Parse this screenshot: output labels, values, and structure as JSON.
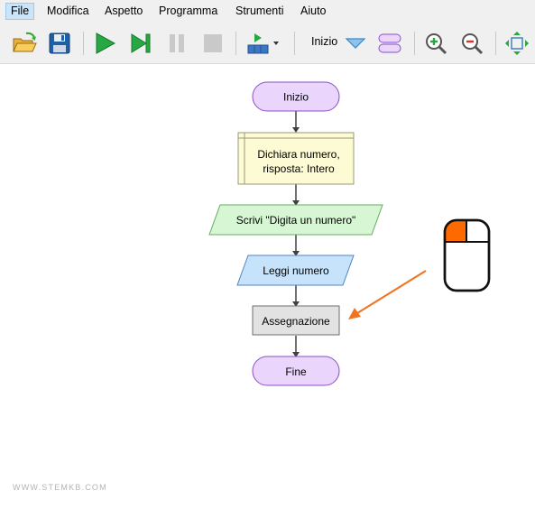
{
  "menu": {
    "items": [
      {
        "label": "File",
        "active": true
      },
      {
        "label": "Modifica"
      },
      {
        "label": "Aspetto"
      },
      {
        "label": "Programma"
      },
      {
        "label": "Strumenti"
      },
      {
        "label": "Aiuto"
      }
    ]
  },
  "toolbar": {
    "start_symbol_label": "Inizio",
    "buttons": [
      "open-folder-icon",
      "save-icon",
      "run-icon",
      "step-icon",
      "pause-icon",
      "stop-icon",
      "run-speed-icon",
      "dropdown-arrow-icon",
      "terminal-shape-icon",
      "zoom-in-icon",
      "zoom-out-icon",
      "fit-icon"
    ]
  },
  "flowchart": {
    "nodes": {
      "start": "Inizio",
      "declare_line1": "Dichiara numero,",
      "declare_line2": "risposta: Intero",
      "output": "Scrivi \"Digita un numero\"",
      "input": "Leggi numero",
      "assign": "Assegnazione",
      "end": "Fine"
    },
    "colors": {
      "terminal": "#ead6fc",
      "declare": "#fdfbd3",
      "output": "#d7f7d4",
      "input": "#c6e3fb",
      "assign": "#e2e2e2",
      "arrow": "#f07422",
      "mouse_left_button": "#ff6a00"
    }
  },
  "watermark": "WWW.STEMKB.COM"
}
